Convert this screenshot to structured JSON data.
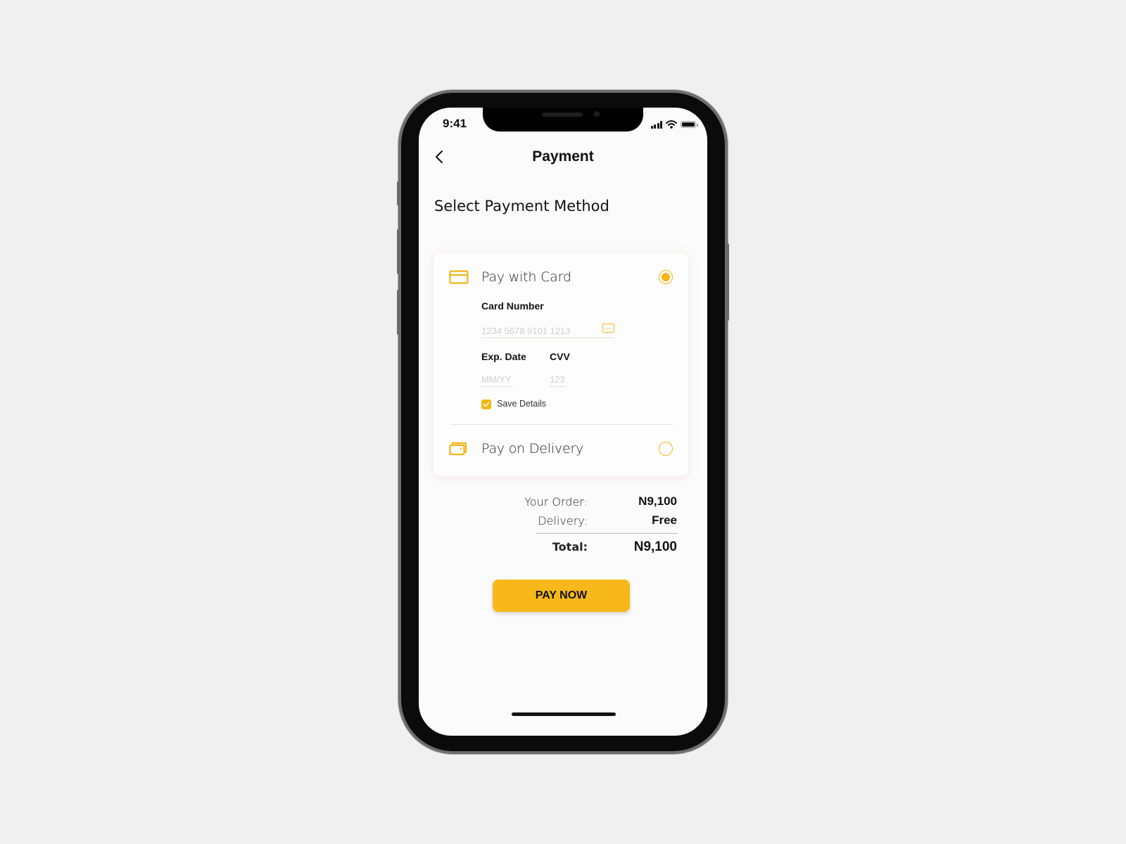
{
  "status_bar": {
    "time": "9:41"
  },
  "header": {
    "title": "Payment"
  },
  "section_title": "Select Payment Method",
  "payment_options": [
    {
      "label": "Pay with Card",
      "icon": "credit-card-icon",
      "selected": true
    },
    {
      "label": "Pay on Delivery",
      "icon": "wallet-icon",
      "selected": false
    }
  ],
  "card_form": {
    "card_number_label": "Card Number",
    "card_number_placeholder": "1234 5678 9101 1213",
    "exp_label": "Exp. Date",
    "exp_placeholder": "MM/YY",
    "cvv_label": "CVV",
    "cvv_placeholder": "123",
    "save_details_label": "Save Details",
    "save_details_checked": true
  },
  "summary": {
    "order_label": "Your Order:",
    "order_value": "N9,100",
    "delivery_label": "Delivery:",
    "delivery_value": "Free",
    "total_label": "Total:",
    "total_value": "N9,100"
  },
  "pay_button_label": "PAY NOW",
  "colors": {
    "accent": "#f5b614",
    "button": "#f8b819"
  }
}
